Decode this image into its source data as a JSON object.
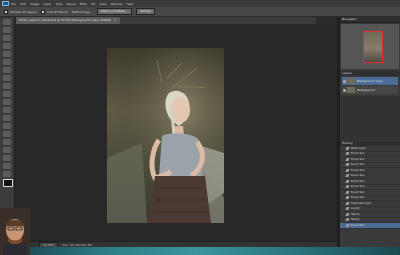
{
  "menubar": {
    "items": [
      "File",
      "Edit",
      "Image",
      "Layer",
      "Type",
      "Select",
      "Filter",
      "3D",
      "View",
      "Window",
      "Help"
    ]
  },
  "options": {
    "sample_all_layers": "Sample All Layers",
    "auto_enhance": "Auto-Enhance",
    "refine_edge": "Refine Edge...",
    "btn_1": "Select and Mask...",
    "btn_2": "Sample"
  },
  "document": {
    "tab_title": "Photo_retouch_2016.psd @ 33.3% (Background copy, RGB/8)",
    "close": "×"
  },
  "status": {
    "zoom": "33.33%",
    "doc_info": "Doc: 60.2M/120.4M"
  },
  "panels": {
    "navigator_title": "Navigator",
    "layers_title": "Layers",
    "layers": [
      {
        "name": "Background copy",
        "selected": true
      },
      {
        "name": "Background",
        "selected": false
      }
    ],
    "history_title": "History",
    "history": [
      {
        "name": "Make Layer",
        "current": false
      },
      {
        "name": "Brush Tool",
        "current": false
      },
      {
        "name": "Brush Tool",
        "current": false
      },
      {
        "name": "Brush Tool",
        "current": false
      },
      {
        "name": "Brush Tool",
        "current": false
      },
      {
        "name": "Brush Tool",
        "current": false
      },
      {
        "name": "Brush Tool",
        "current": false
      },
      {
        "name": "Brush Tool",
        "current": false
      },
      {
        "name": "Brush Tool",
        "current": false
      },
      {
        "name": "Brush Tool",
        "current": false
      },
      {
        "name": "Duplicate Layer",
        "current": false
      },
      {
        "name": "Liquify",
        "current": false
      },
      {
        "name": "Stamp",
        "current": false
      },
      {
        "name": "Stamp",
        "current": false
      },
      {
        "name": "Brush Tool",
        "current": true
      }
    ]
  },
  "colors": {
    "selection": "#4b6c94",
    "canvas_bg": "#282828",
    "nav_frame": "#e03030"
  }
}
